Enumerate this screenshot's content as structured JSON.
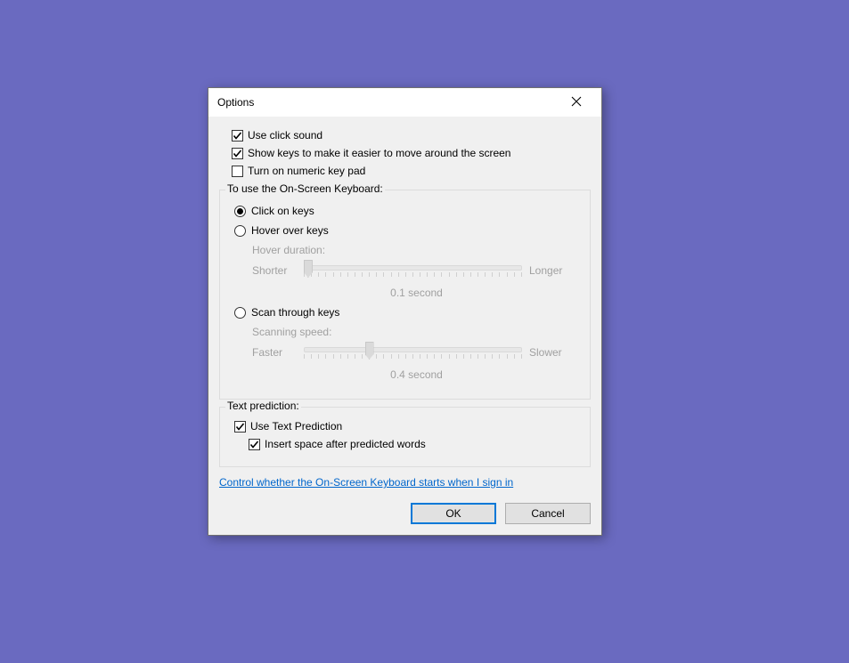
{
  "dialog": {
    "title": "Options"
  },
  "checks": {
    "click_sound": {
      "label": "Use click sound",
      "checked": true
    },
    "show_keys": {
      "label": "Show keys to make it easier to move around the screen",
      "checked": true
    },
    "numeric_pad": {
      "label": "Turn on numeric key pad",
      "checked": false
    }
  },
  "usage": {
    "legend": "To use the On-Screen Keyboard:",
    "mode": "click",
    "click_label": "Click on keys",
    "hover_label": "Hover over keys",
    "scan_label": "Scan through keys",
    "hover": {
      "title": "Hover duration:",
      "left": "Shorter",
      "right": "Longer",
      "value_label": "0.1 second",
      "thumb_percent": 2
    },
    "scan": {
      "title": "Scanning speed:",
      "left": "Faster",
      "right": "Slower",
      "value_label": "0.4 second",
      "thumb_percent": 30
    }
  },
  "prediction": {
    "legend": "Text prediction:",
    "use_tp": {
      "label": "Use Text Prediction",
      "checked": true
    },
    "insert_sp": {
      "label": "Insert space after predicted words",
      "checked": true
    }
  },
  "link": {
    "label": "Control whether the On-Screen Keyboard starts when I sign in"
  },
  "buttons": {
    "ok": "OK",
    "cancel": "Cancel"
  }
}
